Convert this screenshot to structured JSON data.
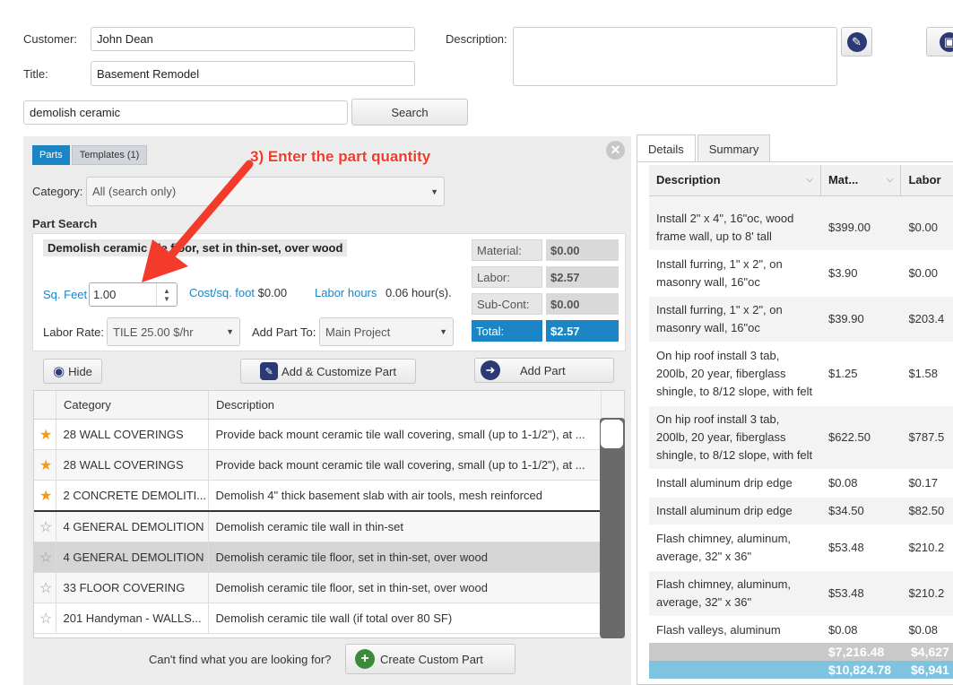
{
  "header": {
    "customer_label": "Customer:",
    "customer_value": "John Dean",
    "title_label": "Title:",
    "title_value": "Basement Remodel",
    "description_label": "Description:",
    "search_value": "demolish ceramic",
    "search_button": "Search"
  },
  "panel": {
    "tabs": [
      {
        "label": "Parts",
        "active": true
      },
      {
        "label": "Templates (1)",
        "active": false
      }
    ],
    "annotation": "3) Enter the part quantity",
    "category_label": "Category:",
    "category_value": "All (search only)",
    "part_search_heading": "Part Search",
    "part_title": "Demolish ceramic tile floor, set in thin-set, over wood",
    "qty_label": "Sq. Feet",
    "qty_value": "1.00",
    "cost_label": "Cost/sq. foot",
    "cost_value": "$0.00",
    "labor_hours_label": "Labor hours",
    "labor_hours_value": "0.06",
    "labor_hours_unit": "hour(s).",
    "labor_rate_label": "Labor Rate:",
    "labor_rate_value": "TILE 25.00 $/hr",
    "add_to_label": "Add Part To:",
    "add_to_value": "Main Project",
    "summary": {
      "material_label": "Material:",
      "material_value": "$0.00",
      "labor_label": "Labor:",
      "labor_value": "$2.57",
      "subcont_label": "Sub-Cont:",
      "subcont_value": "$0.00",
      "total_label": "Total:",
      "total_value": "$2.57"
    },
    "hide_button": "Hide",
    "customize_button": "Add & Customize Part",
    "add_part_button": "Add Part",
    "table_headers": {
      "category": "Category",
      "description": "Description"
    },
    "rows": [
      {
        "star": true,
        "category": "28 WALL COVERINGS",
        "description": "Provide back mount ceramic tile wall covering, small (up to 1-1/2\"), at ..."
      },
      {
        "star": true,
        "category": "28 WALL COVERINGS",
        "description": "Provide back mount ceramic tile wall covering, small (up to 1-1/2\"), at ..."
      },
      {
        "star": true,
        "category": "2 CONCRETE DEMOLITI...",
        "description": "Demolish 4\" thick basement slab with air tools, mesh reinforced"
      },
      {
        "star": false,
        "category": "4 GENERAL DEMOLITION",
        "description": "Demolish ceramic tile wall in thin-set"
      },
      {
        "star": false,
        "category": "4 GENERAL DEMOLITION",
        "description": "Demolish ceramic tile floor, set in thin-set, over wood",
        "selected": true
      },
      {
        "star": false,
        "category": "33 FLOOR COVERING",
        "description": "Demolish ceramic tile floor, set in thin-set, over wood"
      },
      {
        "star": false,
        "category": "201 Handyman - WALLS...",
        "description": "Demolish ceramic tile wall (if total over 80 SF)"
      }
    ],
    "cant_find_text": "Can't find what you are looking for?",
    "create_custom_button": "Create Custom Part"
  },
  "details": {
    "tabs": [
      {
        "label": "Details",
        "active": true
      },
      {
        "label": "Summary",
        "active": false
      }
    ],
    "headers": {
      "description": "Description",
      "material": "Mat...",
      "labor": "Labor"
    },
    "rows": [
      {
        "description": "Install 2\" x 4\", 16\"oc, wood frame wall, up to 8' tall",
        "material": "$399.00",
        "labor": "$0.00"
      },
      {
        "description": "Install furring, 1\" x 2\", on masonry wall, 16\"oc",
        "material": "$3.90",
        "labor": "$0.00"
      },
      {
        "description": "Install furring, 1\" x 2\", on masonry wall, 16\"oc",
        "material": "$39.90",
        "labor": "$203.4"
      },
      {
        "description": "On hip roof install 3 tab, 200lb, 20 year, fiberglass shingle, to 8/12 slope, with felt",
        "material": "$1.25",
        "labor": "$1.58"
      },
      {
        "description": "On hip roof install 3 tab, 200lb, 20 year, fiberglass shingle, to 8/12 slope, with felt",
        "material": "$622.50",
        "labor": "$787.5"
      },
      {
        "description": "Install aluminum drip edge",
        "material": "$0.08",
        "labor": "$0.17"
      },
      {
        "description": "Install aluminum drip edge",
        "material": "$34.50",
        "labor": "$82.50"
      },
      {
        "description": "Flash chimney, aluminum, average, 32\" x 36\"",
        "material": "$53.48",
        "labor": "$210.2"
      },
      {
        "description": "Flash chimney, aluminum, average, 32\" x 36\"",
        "material": "$53.48",
        "labor": "$210.2"
      },
      {
        "description": "Flash valleys, aluminum",
        "material": "$0.08",
        "labor": "$0.08"
      }
    ],
    "totals": {
      "material": "$7,216.48",
      "labor": "$4,627"
    },
    "grand_totals": {
      "material": "$10,824.78",
      "labor": "$6,941"
    }
  },
  "colors": {
    "accent": "#1b85c6",
    "navy": "#2b3a75",
    "annotation": "#f23b2a",
    "star": "#f39c12"
  }
}
